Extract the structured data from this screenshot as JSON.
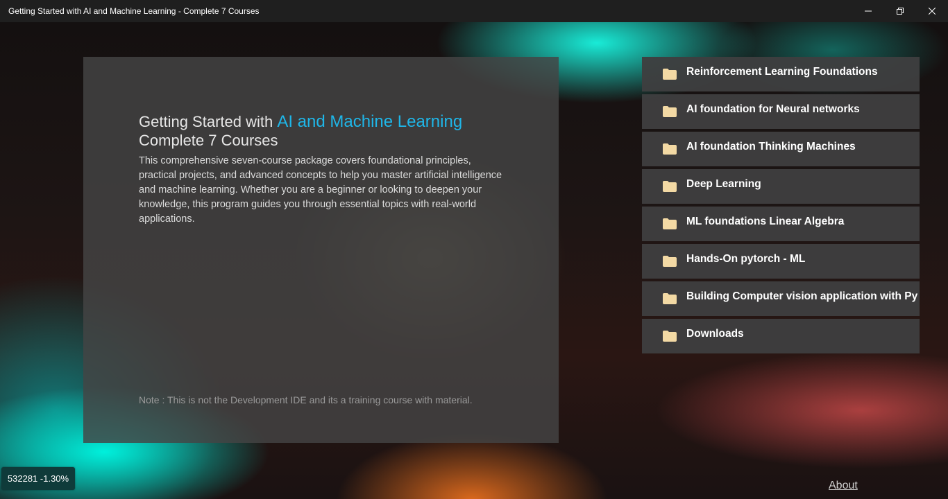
{
  "window": {
    "title": "Getting Started with AI and Machine Learning - Complete 7 Courses",
    "controls": [
      "minimize",
      "restore",
      "close"
    ]
  },
  "card": {
    "heading_prefix": "Getting Started with ",
    "heading_accent": "AI and Machine Learning",
    "heading_line2": "Complete 7 Courses",
    "description": "This comprehensive seven-course package covers foundational principles, practical projects, and advanced concepts to help you master artificial intelligence and machine learning. Whether you are a beginner or looking to deepen your knowledge, this program guides you through essential topics with real-world applications.",
    "note": "Note : This is not the Development IDE and its a training course with material."
  },
  "courses": [
    {
      "label": "Reinforcement Learning Foundations",
      "icon": "folder-icon"
    },
    {
      "label": "AI foundation for Neural networks",
      "icon": "folder-icon"
    },
    {
      "label": "AI foundation Thinking Machines",
      "icon": "folder-icon"
    },
    {
      "label": "Deep Learning",
      "icon": "folder-icon"
    },
    {
      "label": "ML foundations Linear Algebra",
      "icon": "folder-icon"
    },
    {
      "label": "Hands-On pytorch - ML",
      "icon": "folder-icon"
    },
    {
      "label": "Building Computer vision application with Py",
      "icon": "folder-icon"
    },
    {
      "label": "Downloads",
      "icon": "folder-icon"
    }
  ],
  "ticker": {
    "text": "532281 -1.30%"
  },
  "about": {
    "label": "About"
  },
  "colors": {
    "accent": "#1fb6e8",
    "card_bg": "#444444",
    "list_bg": "#3e3e40",
    "folder": "#f3d9a4",
    "titlebar": "#1f1f1f",
    "ticker_bg": "#0f3b3a"
  }
}
